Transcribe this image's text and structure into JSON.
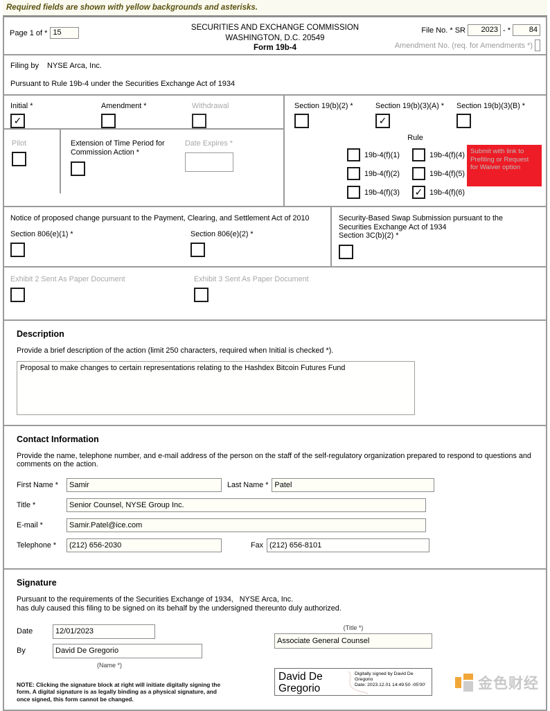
{
  "banner": {
    "text": "Required fields are shown with yellow backgrounds and asterisks."
  },
  "header": {
    "page_label": "Page 1 of *",
    "page_total": "15",
    "agency_line1": "SECURITIES AND EXCHANGE COMMISSION",
    "agency_line2": "WASHINGTON, D.C. 20549",
    "form_name": "Form 19b-4",
    "file_no_label": "File No. * SR",
    "file_no_year": "2023",
    "file_no_dash": "- *",
    "file_no_seq": "84",
    "amendment_no_label": "Amendment No. (req. for Amendments *)",
    "amendment_no_value": ""
  },
  "filing": {
    "filing_by_label": "Filing by",
    "organization": "NYSE Arca, Inc.",
    "pursuant_text": "Pursuant to Rule 19b-4 under the Securities Exchange Act of 1934"
  },
  "filing_type": {
    "left": [
      {
        "label": "Initial *",
        "checked": true,
        "dim": false
      },
      {
        "label": "Amendment *",
        "checked": false,
        "dim": false
      },
      {
        "label": "Withdrawal",
        "checked": false,
        "dim": true
      }
    ],
    "right": [
      {
        "label": "Section 19(b)(2) *",
        "checked": false
      },
      {
        "label": "Section 19(b)(3)(A) *",
        "checked": true
      },
      {
        "label": "Section 19(b)(3)(B) *",
        "checked": false
      }
    ]
  },
  "pilot_row": {
    "pilot_label": "Pilot",
    "pilot_checked": false,
    "extension_label": "Extension of Time Period for\nCommission Action *",
    "extension_checked": false,
    "date_expires_label": "Date Expires *",
    "date_expires_value": ""
  },
  "rule": {
    "title": "Rule",
    "col1": [
      {
        "label": "19b-4(f)(1)",
        "checked": false
      },
      {
        "label": "19b-4(f)(2)",
        "checked": false
      },
      {
        "label": "19b-4(f)(3)",
        "checked": false
      }
    ],
    "col2": [
      {
        "label": "19b-4(f)(4)",
        "checked": false
      },
      {
        "label": "19b-4(f)(5)",
        "checked": false
      },
      {
        "label": "19b-4(f)(6)",
        "checked": true
      }
    ],
    "submit_button_label": "Submit with link to Prefiling or Request for Waiver option",
    "submit_button_color": "#ee1c26"
  },
  "pcs": {
    "notice_text": "Notice of proposed change pursuant to the Payment, Clearing, and Settlement Act of 2010",
    "section_806e1_label": "Section 806(e)(1) *",
    "section_806e1_checked": false,
    "section_806e2_label": "Section 806(e)(2) *",
    "section_806e2_checked": false,
    "swap_line1": "Security-Based Swap Submission pursuant to the",
    "swap_line2": "Securities Exchange Act of 1934",
    "swap_line3": "Section 3C(b)(2) *",
    "swap_checked": false
  },
  "exhibits": [
    {
      "label": "Exhibit 2 Sent As Paper Document",
      "checked": false
    },
    {
      "label": "Exhibit 3 Sent As Paper Document",
      "checked": false
    }
  ],
  "description": {
    "heading": "Description",
    "instruction": "Provide a brief description of the action (limit 250 characters, required when Initial is checked *).",
    "value": "Proposal to make changes to certain representations relating to the Hashdex Bitcoin Futures Fund"
  },
  "contact": {
    "heading": "Contact Information",
    "instruction": "Provide the name, telephone number, and e-mail address of the person on the staff of the self-regulatory organization prepared to respond to questions and comments on the action.",
    "first_name_label": "First Name *",
    "first_name": "Samir",
    "last_name_label": "Last Name *",
    "last_name": "Patel",
    "title_label": "Title *",
    "title": "Senior Counsel, NYSE Group Inc.",
    "email_label": "E-mail *",
    "email": "Samir.Patel@ice.com",
    "telephone_label": "Telephone *",
    "telephone": "(212) 656-2030",
    "fax_label": "Fax",
    "fax": "(212) 656-8101"
  },
  "signature": {
    "heading": "Signature",
    "pursuant_line1": "Pursuant to the requirements of the Securities Exchange of 1934,",
    "organization": "NYSE Arca, Inc.",
    "pursuant_line2": "has duly caused this filing to be signed on its behalf by the undersigned thereunto duly authorized.",
    "date_label": "Date",
    "date_value": "12/01/2023",
    "by_label": "By",
    "by_value": "David De Gregorio",
    "name_caption": "(Name *)",
    "title_caption": "(Title *)",
    "title_value": "Associate General Counsel",
    "note": "NOTE: Clicking the signature block at right will initiate digitally signing the form. A digital signature is as legally binding as a physical signature, and once signed, this form cannot be changed.",
    "signature_name": "David De Gregorio",
    "signature_meta_line1": "Digitally signed by David De Gregorio",
    "signature_meta_line2": "Date: 2023.12.01 14:49:50 -05'00'"
  },
  "watermark": {
    "text": "金色财经",
    "accent_color": "#f0a028"
  }
}
